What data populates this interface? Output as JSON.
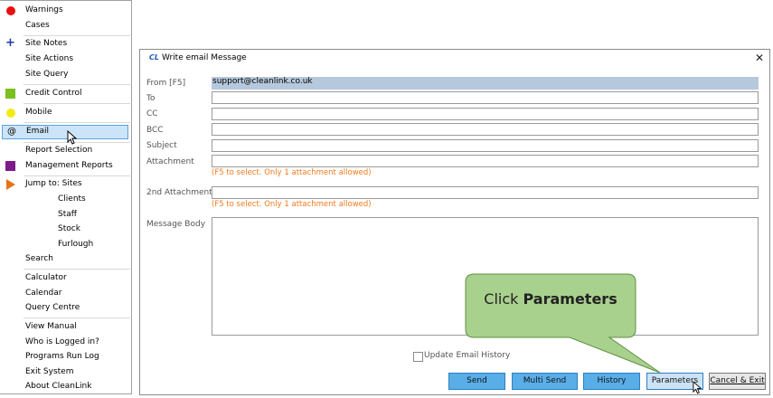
{
  "menu": {
    "items": [
      {
        "label": "Warnings",
        "icon": "red-circle-icon"
      },
      {
        "label": "Cases"
      },
      {
        "label": "Site Notes",
        "icon": "plus-icon"
      },
      {
        "label": "Site Actions"
      },
      {
        "label": "Site Query"
      },
      {
        "label": "Credit Control",
        "icon": "green-square-icon"
      },
      {
        "label": "Mobile",
        "icon": "yellow-circle-icon"
      },
      {
        "label": "Email",
        "icon": "at-icon",
        "selected": true
      },
      {
        "label": "Report Selection"
      },
      {
        "label": "Management Reports",
        "icon": "purple-square-icon"
      },
      {
        "label": "Jump to: Sites",
        "icon": "orange-play-icon"
      },
      {
        "label": "Clients"
      },
      {
        "label": "Staff"
      },
      {
        "label": "Stock"
      },
      {
        "label": "Furlough"
      },
      {
        "label": "Search"
      },
      {
        "label": "Calculator"
      },
      {
        "label": "Calendar"
      },
      {
        "label": "Query Centre"
      },
      {
        "label": "View Manual"
      },
      {
        "label": "Who is Logged in?"
      },
      {
        "label": "Programs Run Log"
      },
      {
        "label": "Exit System"
      },
      {
        "label": "About CleanLink"
      }
    ]
  },
  "dialog": {
    "logo": "CL",
    "title": "Write email Message",
    "close": "✕",
    "fields": {
      "from_label": "From [F5]",
      "from_value": "support@cleanlink.co.uk",
      "to_label": "To",
      "to_value": "",
      "cc_label": "CC",
      "cc_value": "",
      "bcc_label": "BCC",
      "bcc_value": "",
      "subject_label": "Subject",
      "subject_value": "",
      "attachment_label": "Attachment",
      "attachment_value": "",
      "attachment_hint": "(F5 to select. Only 1 attachment allowed)",
      "attachment2_label": "2nd Attachment",
      "attachment2_value": "",
      "attachment2_hint": "(F5 to select. Only 1 attachment allowed)",
      "body_label": "Message Body",
      "body_value": ""
    },
    "update_history_label": "Update Email History",
    "update_history_checked": false,
    "buttons": {
      "send": "Send",
      "multi_send": "Multi Send",
      "history": "History",
      "parameters": "Parameters",
      "cancel": "Cancel & Exit"
    }
  },
  "callout": {
    "prefix": "Click ",
    "emphasis": "Parameters"
  },
  "colors": {
    "callout_fill": "#a9d18e",
    "callout_border": "#5f8f3f",
    "button_blue": "#5aaee8",
    "hint_orange": "#f07b1c",
    "selection_blue": "#cce4f7"
  }
}
